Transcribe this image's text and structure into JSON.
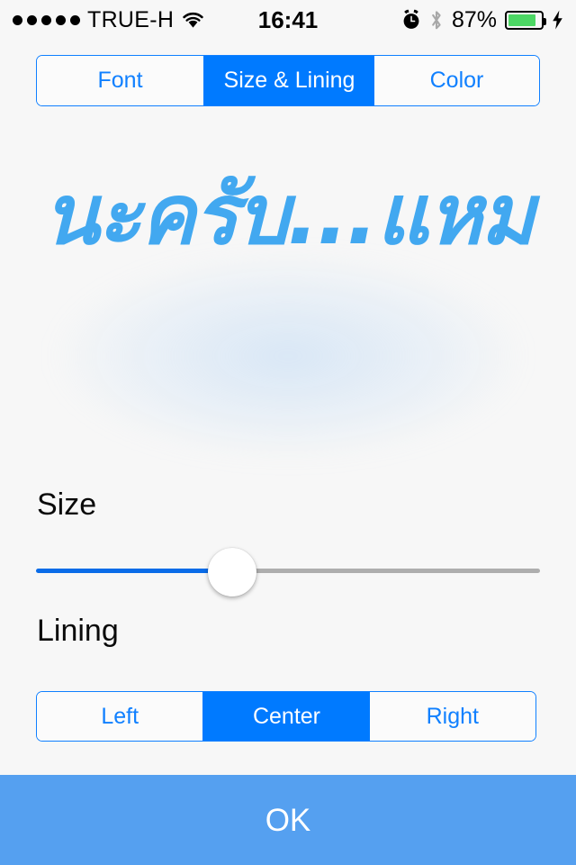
{
  "status_bar": {
    "signal_dots": 5,
    "carrier": "TRUE-H",
    "wifi_icon": "wifi-icon",
    "time": "16:41",
    "alarm_icon": "alarm-clock-icon",
    "bluetooth_icon": "bluetooth-icon",
    "battery_percent": "87%",
    "battery_level": 87,
    "charging_icon": "lightning-bolt-icon",
    "battery_color": "#4CD764"
  },
  "tabs": {
    "items": [
      {
        "label": "Font",
        "selected": false
      },
      {
        "label": "Size & Lining",
        "selected": true
      },
      {
        "label": "Color",
        "selected": false
      }
    ],
    "accent_color": "#007AFF",
    "border_color": "#1080FF"
  },
  "preview": {
    "text": "นะครับ...แหม",
    "text_color": "#42A8F0"
  },
  "size_section": {
    "label": "Size",
    "slider": {
      "value_percent": 39,
      "fill_color": "#0A6CE8",
      "track_color": "#AEAEAE",
      "thumb_color": "#FFFFFF"
    }
  },
  "lining_section": {
    "label": "Lining",
    "options": [
      {
        "label": "Left",
        "selected": false
      },
      {
        "label": "Center",
        "selected": true
      },
      {
        "label": "Right",
        "selected": false
      }
    ]
  },
  "footer": {
    "ok_label": "OK",
    "ok_background": "#55A0F0"
  }
}
